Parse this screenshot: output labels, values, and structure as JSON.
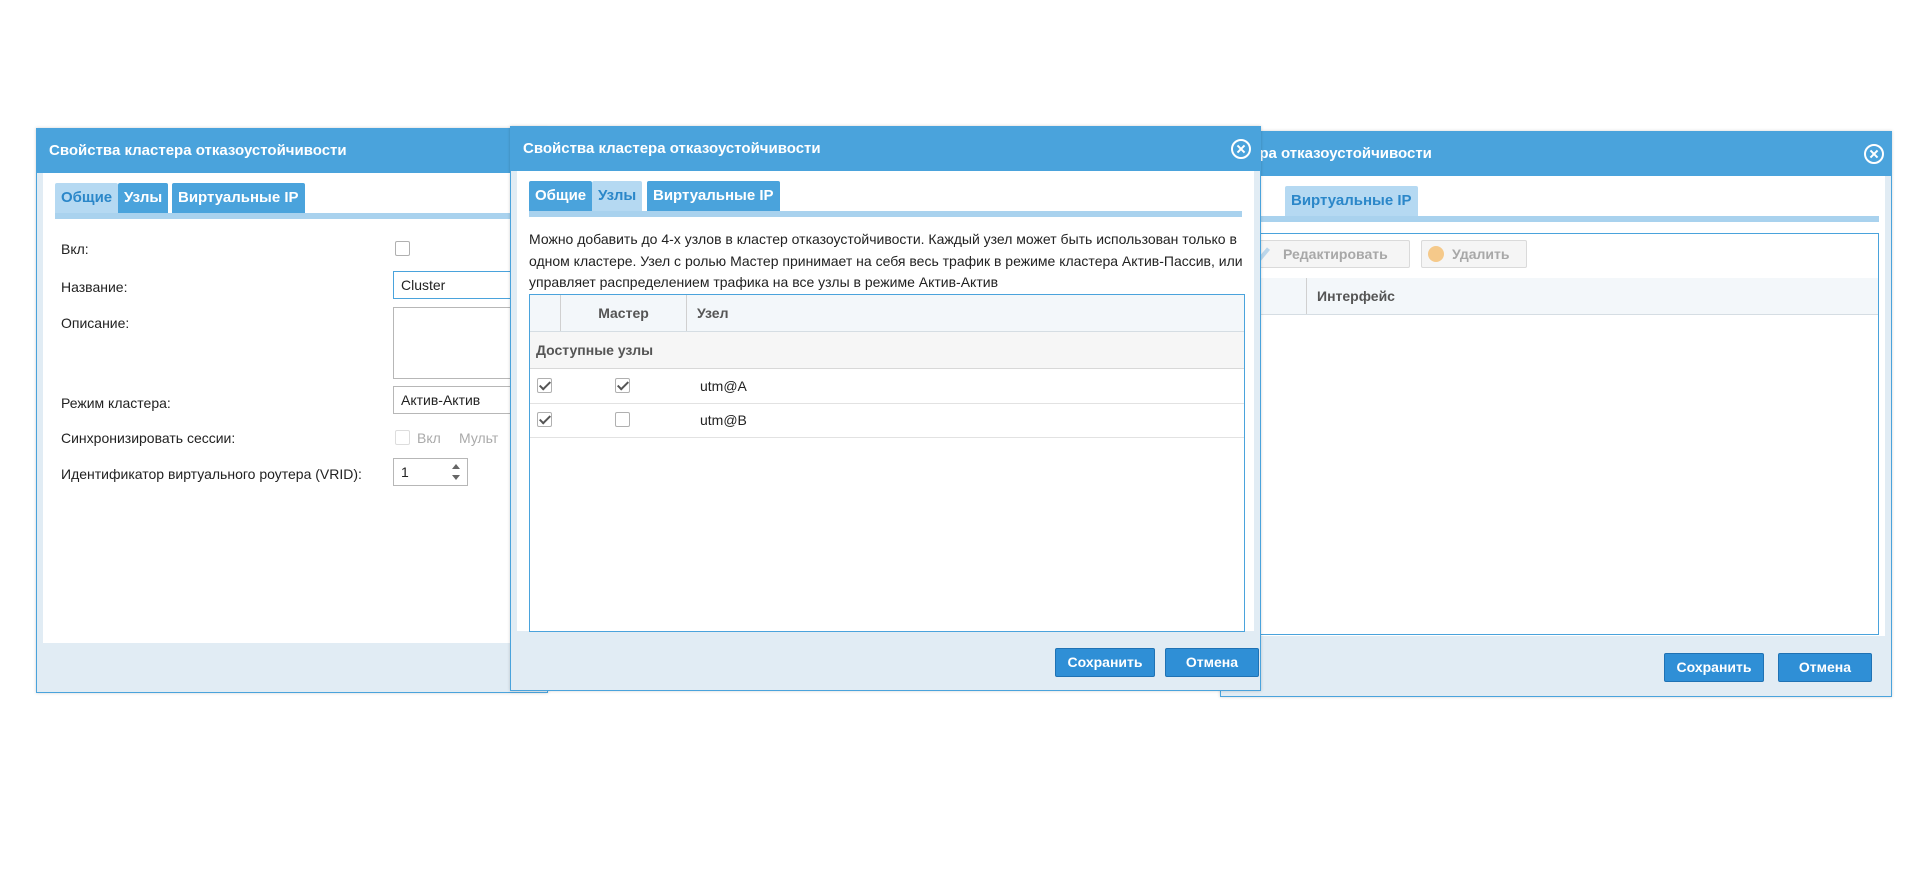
{
  "dialog1": {
    "title": "Свойства кластера отказоустойчивости",
    "tabs": [
      "Общие",
      "Узлы",
      "Виртуальные IP"
    ],
    "fields": {
      "enabled_label": "Вкл:",
      "name_label": "Название:",
      "name_value": "Cluster",
      "description_label": "Описание:",
      "mode_label": "Режим кластера:",
      "mode_value": "Актив-Актив",
      "sync_label": "Синхронизировать сессии:",
      "sync_on": "Вкл",
      "sync_multi": "Мульт",
      "vrid_label": "Идентификатор виртуального роутера (VRID):",
      "vrid_value": "1"
    }
  },
  "dialog2": {
    "title": "Свойства кластера отказоустойчивости",
    "tabs": [
      "Общие",
      "Узлы",
      "Виртуальные IP"
    ],
    "description": "Можно добавить до 4-х узлов в кластер отказоустойчивости. Каждый узел может быть использован только в одном кластере. Узел с ролью Мастер принимает на себя весь трафик в режиме кластера Актив-Пассив, или управляет распределением трафика на все узлы в режиме Актив-Актив",
    "columns": [
      "Мастер",
      "Узел"
    ],
    "group_label": "Доступные узлы",
    "rows": [
      {
        "selected": true,
        "master": true,
        "node": "utm@A"
      },
      {
        "selected": true,
        "master": false,
        "node": "utm@B"
      }
    ],
    "save": "Сохранить",
    "cancel": "Отмена"
  },
  "dialog3": {
    "title": "ера отказоустойчивости",
    "tab": "Виртуальные IP",
    "toolbar": {
      "edit": "Редактировать",
      "delete": "Удалить"
    },
    "columns": [
      "Интерфейс"
    ],
    "save": "Сохранить",
    "cancel": "Отмена"
  }
}
